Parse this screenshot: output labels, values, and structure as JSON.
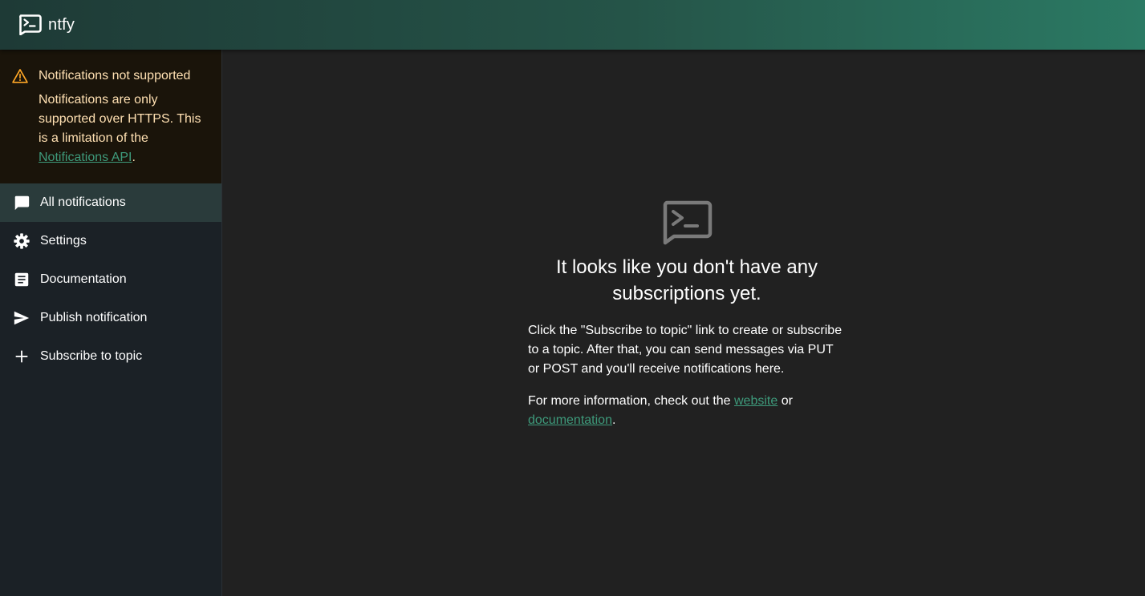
{
  "app": {
    "title": "ntfy"
  },
  "alert": {
    "title": "Notifications not supported",
    "text_before_link": "Notifications are only supported over HTTPS. This is a limitation of the ",
    "link_text": "Notifications API",
    "text_after_link": "."
  },
  "sidebar": {
    "items": [
      {
        "label": "All notifications",
        "icon": "chat-bubble-icon",
        "selected": true
      },
      {
        "label": "Settings",
        "icon": "gear-icon",
        "selected": false
      },
      {
        "label": "Documentation",
        "icon": "article-icon",
        "selected": false
      },
      {
        "label": "Publish notification",
        "icon": "send-icon",
        "selected": false
      },
      {
        "label": "Subscribe to topic",
        "icon": "plus-icon",
        "selected": false
      }
    ]
  },
  "main": {
    "heading": "It looks like you don't have any subscriptions yet.",
    "paragraph1": "Click the \"Subscribe to topic\" link to create or subscribe to a topic. After that, you can send messages via PUT or POST and you'll receive notifications here.",
    "paragraph2_before": "For more information, check out the ",
    "website_link": "website",
    "paragraph2_middle": " or ",
    "documentation_link": "documentation",
    "paragraph2_after": "."
  },
  "colors": {
    "appbar_gradient_start": "#1e3a36",
    "appbar_gradient_end": "#2b7a64",
    "sidebar_bg": "#1b2126",
    "alert_bg": "#1a140a",
    "alert_text": "#ffe0b2",
    "warning_icon": "#ffa726",
    "link": "#3e9a7b",
    "selected_item_bg": "#2a3b3b",
    "content_bg": "#212121",
    "empty_icon": "#7a7a7a"
  }
}
